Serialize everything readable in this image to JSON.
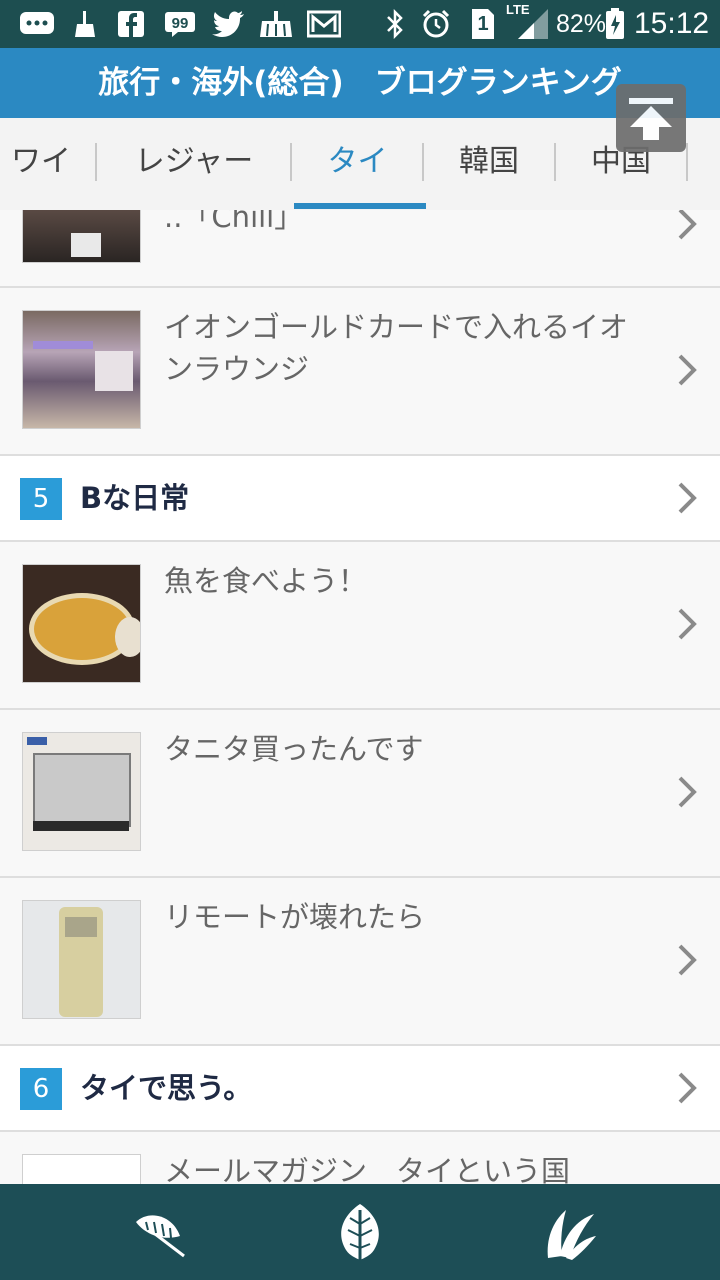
{
  "status_bar": {
    "icons": [
      "chat-bubble-icon",
      "broom-icon",
      "facebook-icon",
      "quote-icon",
      "twitter-icon",
      "sweep-icon",
      "mail-icon",
      "bluetooth-icon",
      "alarm-icon",
      "sim-icon",
      "lte-signal-icon",
      "battery-icon"
    ],
    "sim_slot": "1",
    "network": "LTE",
    "battery": "82%",
    "time": "15:12"
  },
  "header": {
    "title": "旅行・海外(総合)　ブログランキング",
    "scroll_top_icon": "arrow-up-to-top-icon"
  },
  "tabs": {
    "items": [
      "ワイ",
      "レジャー",
      "タイ",
      "韓国",
      "中国"
    ],
    "active": "タイ"
  },
  "list": {
    "partial_top_title": "..「Chill」",
    "entries_block_a": [
      {
        "title": "イオンゴールドカードで入れるイオンラウンジ"
      }
    ],
    "rank5": {
      "rank": "5",
      "blog": "Bな日常"
    },
    "entries_block_b": [
      {
        "title": "魚を食べよう！"
      },
      {
        "title": "タニタ買ったんです"
      },
      {
        "title": "リモートが壊れたら"
      }
    ],
    "rank6": {
      "rank": "6",
      "blog": "タイで思う。"
    },
    "entries_block_c": [
      {
        "title": "メールマガジン　タイという国"
      }
    ]
  },
  "bottom_nav": {
    "icons": [
      "leaf-feather-icon",
      "leaf-icon",
      "palm-leaf-icon"
    ]
  },
  "colors": {
    "header": "#2b89c2",
    "status_bar": "#1d4e50",
    "rank_badge": "#2b9cd8",
    "bottom_nav": "#1d4e56"
  }
}
